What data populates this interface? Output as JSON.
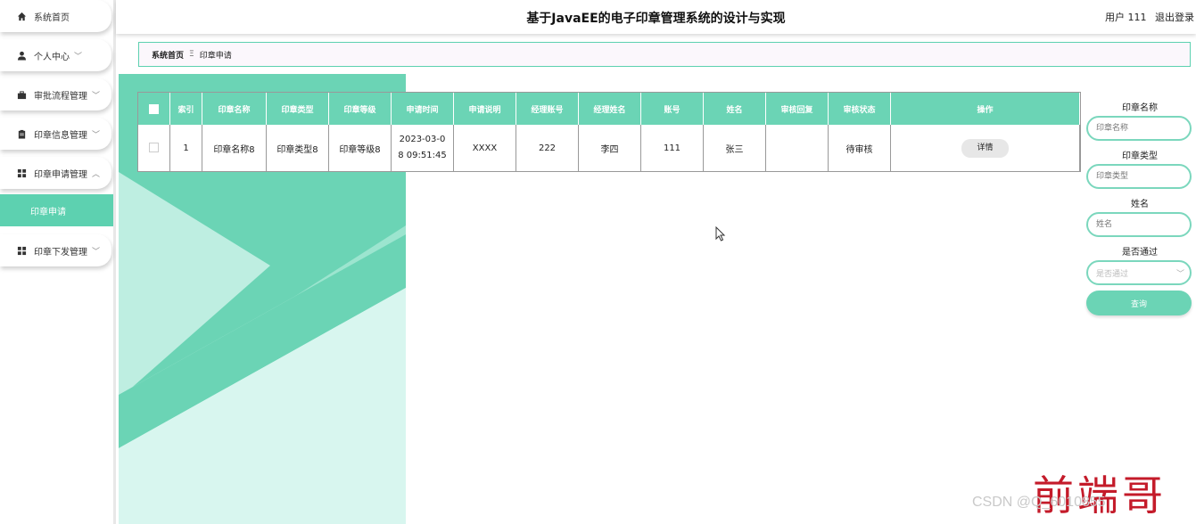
{
  "sidebar": {
    "items": [
      {
        "label": "系统首页",
        "icon": "home-icon"
      },
      {
        "label": "个人中心",
        "icon": "user-icon"
      },
      {
        "label": "审批流程管理",
        "icon": "briefcase-icon"
      },
      {
        "label": "印章信息管理",
        "icon": "clipboard-icon"
      },
      {
        "label": "印章申请管理",
        "icon": "grid-icon"
      },
      {
        "label": "印章下发管理",
        "icon": "grid-icon"
      }
    ],
    "active_sub": "印章申请"
  },
  "header": {
    "title": "基于JavaEE的电子印章管理系统的设计与实现",
    "user": "用户 111",
    "logout": "退出登录"
  },
  "breadcrumb": {
    "home": "系统首页",
    "separator": "Ξ",
    "current": "印章申请"
  },
  "table": {
    "columns": [
      "索引",
      "印章名称",
      "印章类型",
      "印章等级",
      "申请时间",
      "申请说明",
      "经理账号",
      "经理姓名",
      "账号",
      "姓名",
      "审核回复",
      "审核状态",
      "操作"
    ],
    "rows": [
      {
        "index": "1",
        "name": "印章名称8",
        "type": "印章类型8",
        "level": "印章等级8",
        "time": "2023-03-0\n8 09:51:45",
        "desc": "XXXX",
        "mgr_account": "222",
        "mgr_name": "李四",
        "account": "111",
        "username": "张三",
        "reply": "",
        "status": "待审核",
        "action": "详情"
      }
    ]
  },
  "search": {
    "name_label": "印章名称",
    "name_placeholder": "印章名称",
    "type_label": "印章类型",
    "type_placeholder": "印章类型",
    "user_label": "姓名",
    "user_placeholder": "姓名",
    "pass_label": "是否通过",
    "pass_placeholder": "是否通过",
    "button": "查询"
  },
  "watermark": "CSDN @Q_6010855",
  "logo": "前端哥",
  "colors": {
    "accent": "#6bd4b5",
    "logo": "#c41b2a"
  }
}
